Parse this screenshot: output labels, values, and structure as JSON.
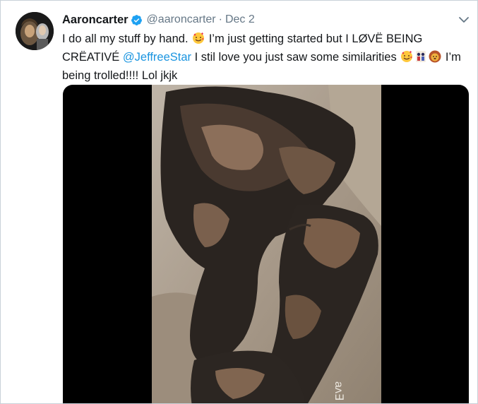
{
  "tweet": {
    "display_name": "Aaroncarter",
    "handle": "@aaroncarter",
    "separator": "·",
    "date": "Dec 2",
    "text_part1": "I do all my stuff by hand. ",
    "text_part2": " I’m just getting started but I LØVË BEING CRËATIVÉ ",
    "mention": "@JeffreeStar",
    "text_part3": " I stil love you just saw some similarities ",
    "text_part4": " I’m being trolled!!!! Lol jkjk",
    "emojis": [
      "smiling-face-with-hearts",
      "smiling-face-with-hearts",
      "pouting-doll",
      "lion-face"
    ]
  },
  "media": {
    "type": "video",
    "icon": "video-player"
  },
  "colors": {
    "link": "#1b95e0",
    "verified": "#1da1f2",
    "muted_text": "#657786",
    "text": "#14171a"
  }
}
